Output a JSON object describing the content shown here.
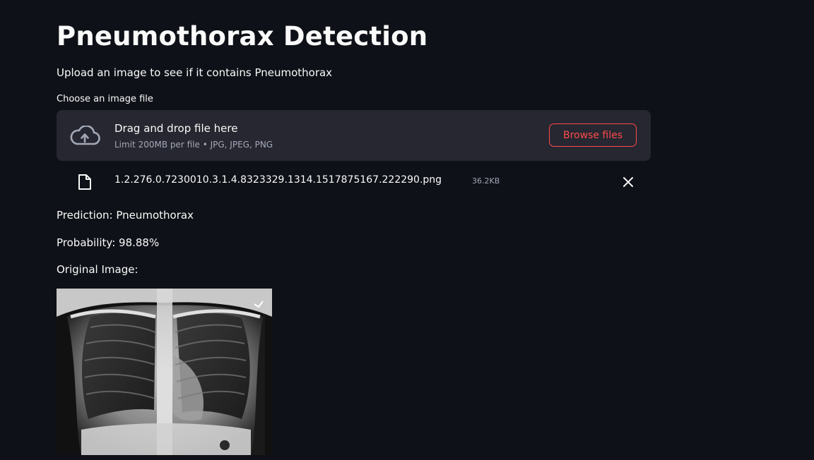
{
  "app": {
    "title": "Pneumothorax Detection",
    "subtitle": "Upload an image to see if it contains Pneumothorax"
  },
  "uploader": {
    "label": "Choose an image file",
    "drop_text": "Drag and drop file here",
    "limit_text": "Limit 200MB per file • JPG, JPEG, PNG",
    "browse_label": "Browse files",
    "icon": "cloud-upload-icon"
  },
  "uploaded_file": {
    "name": "1.2.276.0.7230010.3.1.4.8323329.1314.1517875167.222290.png",
    "size": "36.2KB",
    "icon": "file-icon",
    "remove_icon": "close-icon"
  },
  "results": {
    "prediction": "Prediction: Pneumothorax",
    "probability": "Probability: 98.88%",
    "image_heading": "Original Image:"
  },
  "colors": {
    "background": "#0e1117",
    "panel": "#262730",
    "accent": "#ff4b4b",
    "text": "#fafafa",
    "muted_text": "#a3a8b8"
  }
}
